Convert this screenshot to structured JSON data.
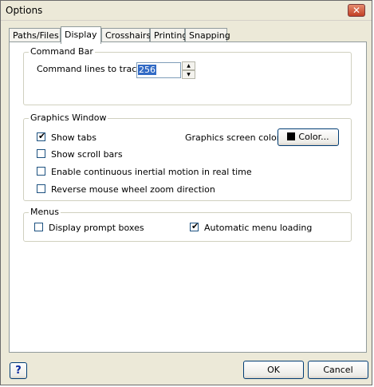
{
  "window": {
    "title": "Options",
    "close_glyph": "✕"
  },
  "tabs": [
    {
      "label": "Paths/Files",
      "active": false
    },
    {
      "label": "Display",
      "active": true
    },
    {
      "label": "Crosshairs",
      "active": false
    },
    {
      "label": "Printing",
      "active": false
    },
    {
      "label": "Snapping",
      "active": false
    }
  ],
  "command_bar": {
    "title": "Command Bar",
    "lines_label": "Command lines to track:",
    "lines_value": "256"
  },
  "graphics_window": {
    "title": "Graphics Window",
    "show_tabs": {
      "label": "Show tabs",
      "checked": true
    },
    "show_scroll_bars": {
      "label": "Show scroll bars",
      "checked": false
    },
    "continuous_motion": {
      "label": "Enable continuous inertial motion in real time",
      "checked": false
    },
    "reverse_wheel": {
      "label": "Reverse mouse wheel zoom direction",
      "checked": false
    },
    "screen_color_label": "Graphics screen color:",
    "color_button_label": "Color...",
    "color_value": "#000000"
  },
  "menus": {
    "title": "Menus",
    "prompt_boxes": {
      "label": "Display prompt boxes",
      "checked": false
    },
    "auto_menu_loading": {
      "label": "Automatic menu loading",
      "checked": true
    }
  },
  "footer": {
    "help_label": "?",
    "ok_label": "OK",
    "cancel_label": "Cancel"
  },
  "icons": {
    "check": "✔",
    "spin_up": "▲",
    "spin_down": "▼"
  }
}
